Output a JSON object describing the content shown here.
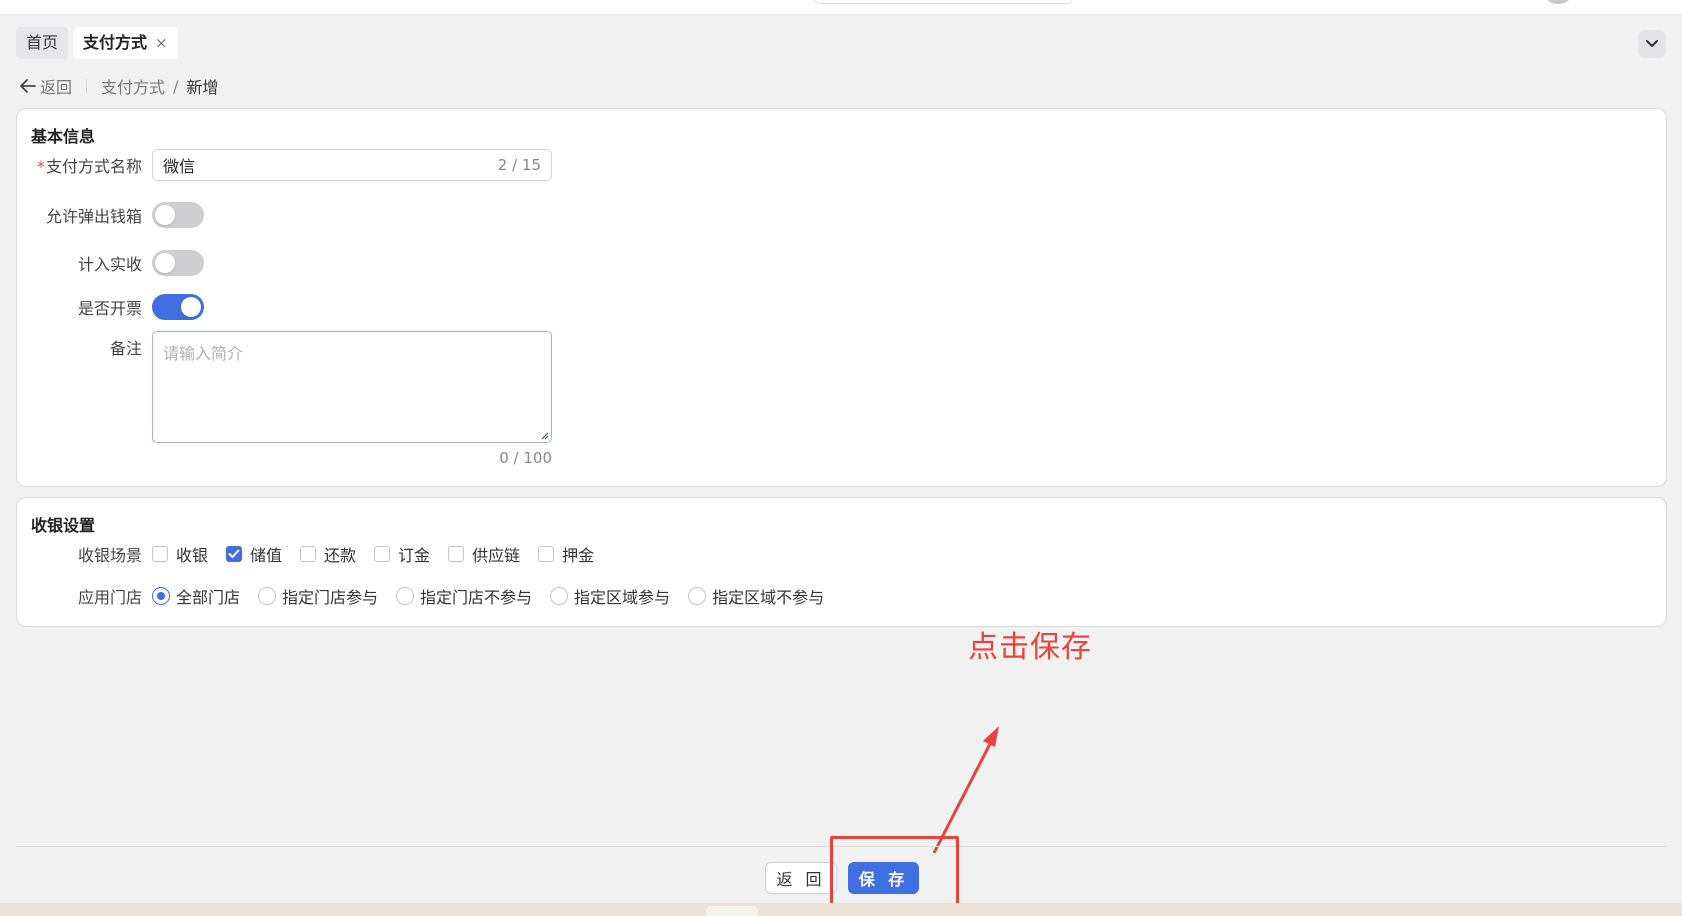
{
  "tabs": [
    {
      "label": "首页",
      "active": false
    },
    {
      "label": "支付方式",
      "active": true
    }
  ],
  "tab_close_glyph": "×",
  "breadcrumb": {
    "back_label": "返回",
    "path": [
      "支付方式",
      "新增"
    ],
    "separator": "/"
  },
  "basic_info": {
    "title": "基本信息",
    "name_field": {
      "required_mark": "*",
      "label": "支付方式名称",
      "value": "微信",
      "counter": "2 / 15"
    },
    "switches": [
      {
        "label": "允许弹出钱箱",
        "on": false
      },
      {
        "label": "计入实收",
        "on": false
      },
      {
        "label": "是否开票",
        "on": true
      }
    ],
    "remark": {
      "label": "备注",
      "placeholder": "请输入简介",
      "counter": "0 / 100"
    }
  },
  "cashier_settings": {
    "title": "收银设置",
    "scene": {
      "label": "收银场景",
      "options": [
        {
          "label": "收银",
          "checked": false
        },
        {
          "label": "储值",
          "checked": true
        },
        {
          "label": "还款",
          "checked": false
        },
        {
          "label": "订金",
          "checked": false
        },
        {
          "label": "供应链",
          "checked": false
        },
        {
          "label": "押金",
          "checked": false
        }
      ]
    },
    "stores": {
      "label": "应用门店",
      "options": [
        {
          "label": "全部门店",
          "selected": true
        },
        {
          "label": "指定门店参与",
          "selected": false
        },
        {
          "label": "指定门店不参与",
          "selected": false
        },
        {
          "label": "指定区域参与",
          "selected": false
        },
        {
          "label": "指定区域不参与",
          "selected": false
        }
      ]
    }
  },
  "annotation": {
    "text": "点击保存",
    "color": "#e8423c"
  },
  "footer": {
    "back_label": "返 回",
    "save_label": "保 存"
  },
  "colors": {
    "primary": "#3f6fe0",
    "required": "#e5484d",
    "annotation": "#e8423c"
  },
  "icons": {
    "back": "arrow-left-icon",
    "tab_collapse": "chevron-down-icon",
    "checkbox_check": "check-icon",
    "textarea_resize": "resize-grip-icon"
  }
}
